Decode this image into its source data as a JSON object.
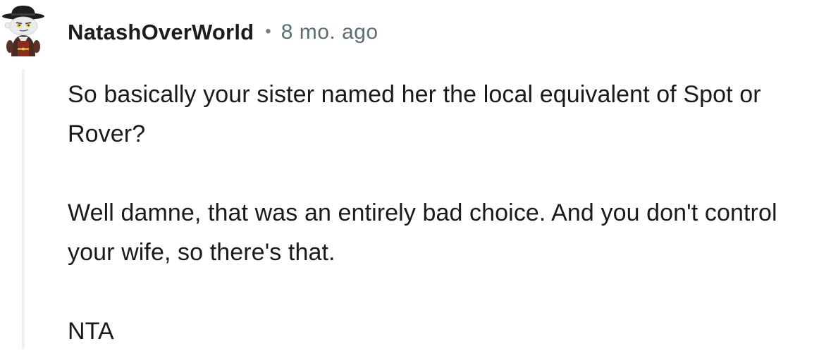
{
  "comment": {
    "avatar_icon": "snoo-cowboy-avatar-icon",
    "username": "NatashOverWorld",
    "separator": "•",
    "timestamp": "8 mo. ago",
    "paragraphs": [
      "So basically your sister named her the local equivalent of Spot or Rover?",
      "Well damne, that was an entirely bad choice. And you don't control your wife, so there's that.",
      "NTA"
    ]
  },
  "colors": {
    "username": "#1c1c1c",
    "timestamp": "#576f76",
    "body_text": "#1a1a1b",
    "thread_line": "#edeff1",
    "background": "#ffffff"
  }
}
